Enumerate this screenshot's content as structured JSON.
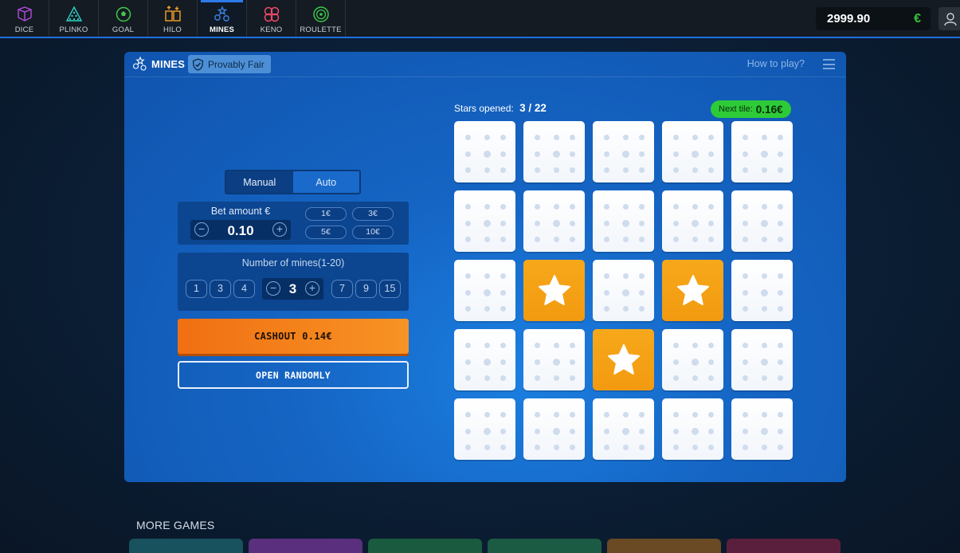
{
  "nav": {
    "tabs": [
      {
        "label": "DICE",
        "icon": "dice-icon",
        "color": "#b44be0"
      },
      {
        "label": "PLINKO",
        "icon": "plinko-icon",
        "color": "#2fd1c8"
      },
      {
        "label": "GOAL",
        "icon": "goal-icon",
        "color": "#42c84a"
      },
      {
        "label": "HILO",
        "icon": "hilo-icon",
        "color": "#f5a02a"
      },
      {
        "label": "MINES",
        "icon": "mines-icon",
        "color": "#3d86ee"
      },
      {
        "label": "KENO",
        "icon": "keno-icon",
        "color": "#f04a6a"
      },
      {
        "label": "ROULETTE",
        "icon": "roulette-icon",
        "color": "#3cc84a"
      }
    ],
    "active": "MINES"
  },
  "balance": {
    "amount": "2999.90",
    "currency": "€"
  },
  "panel": {
    "title": "MINES",
    "badge": "Provably Fair",
    "how_to_play": "How to play?"
  },
  "controls": {
    "mode_manual": "Manual",
    "mode_auto": "Auto",
    "bet_label": "Bet amount €",
    "bet_value": "0.10",
    "chips": [
      "1€",
      "3€",
      "5€",
      "10€"
    ],
    "mines_label": "Number of mines(1-20)",
    "mine_presets_left": [
      "1",
      "3",
      "4"
    ],
    "mine_presets_right": [
      "7",
      "9",
      "15"
    ],
    "mines_value": "3",
    "cashout_label": "CASHOUT 0.14€",
    "random_label": "OPEN RANDOMLY"
  },
  "board": {
    "stars_opened_label": "Stars opened:",
    "stars_opened_value": "3 / 22",
    "next_tile_label": "Next tile:",
    "next_tile_value": "0.16€",
    "tiles": [
      [
        "closed",
        "closed",
        "closed",
        "closed",
        "closed"
      ],
      [
        "closed",
        "closed",
        "closed",
        "closed",
        "closed"
      ],
      [
        "closed",
        "star",
        "closed",
        "star",
        "closed"
      ],
      [
        "closed",
        "closed",
        "star",
        "closed",
        "closed"
      ],
      [
        "closed",
        "closed",
        "closed",
        "closed",
        "closed"
      ]
    ]
  },
  "more_games": {
    "label": "MORE GAMES",
    "card_colors": [
      "#17525e",
      "#5a2f7d",
      "#1a5a3e",
      "#1b5a43",
      "#6a4a24",
      "#5a1f3c"
    ]
  },
  "colors": {
    "accent": "#1f6fe0",
    "star": "#f5a11a",
    "cashout": "#f58220",
    "positive": "#2ecb38"
  }
}
